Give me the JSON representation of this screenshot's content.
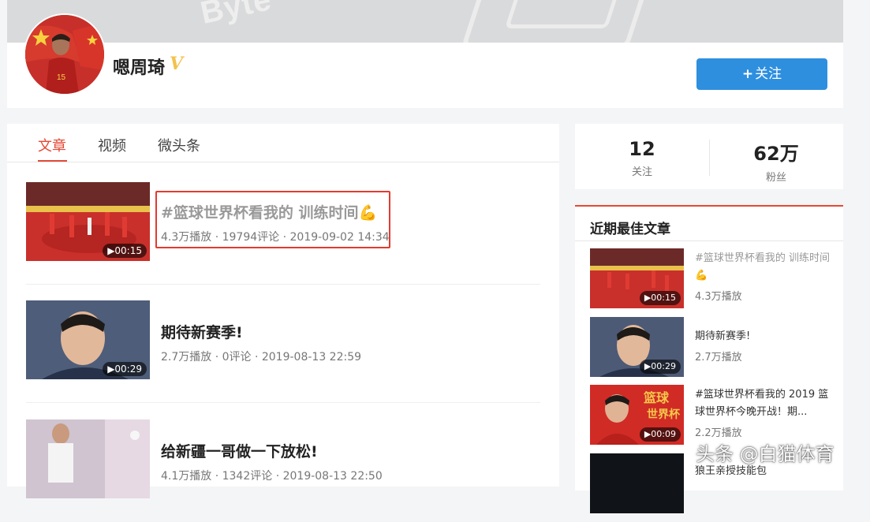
{
  "banner": {
    "logo_text": "Byte"
  },
  "profile": {
    "name": "嗯周琦",
    "verified_badge": "V",
    "follow_label": "关注",
    "follow_plus": "+"
  },
  "tabs": [
    {
      "label": "文章"
    },
    {
      "label": "视频"
    },
    {
      "label": "微头条"
    }
  ],
  "articles": [
    {
      "title": "#篮球世界杯看我的 训练时间💪",
      "meta": "4.3万播放 · 19794评论 · 2019-09-02 14:34",
      "duration": "▶00:15"
    },
    {
      "title": "期待新赛季!",
      "meta": "2.7万播放 · 0评论 · 2019-08-13 22:59",
      "duration": "▶00:29"
    },
    {
      "title": "给新疆一哥做一下放松!",
      "meta": "4.1万播放 · 1342评论 · 2019-08-13 22:50",
      "duration": ""
    }
  ],
  "stats": {
    "following_count": "12",
    "following_label": "关注",
    "fans_count": "62万",
    "fans_label": "粉丝"
  },
  "best": {
    "heading": "近期最佳文章",
    "items": [
      {
        "title": "#篮球世界杯看我的 训练时间💪",
        "meta": "4.3万播放",
        "duration": "▶00:15"
      },
      {
        "title": "期待新赛季!",
        "meta": "2.7万播放",
        "duration": "▶00:29"
      },
      {
        "title": "#篮球世界杯看我的 2019 篮球世界杯今晚开战！期...",
        "meta": "2.2万播放",
        "duration": "▶00:09"
      },
      {
        "title": "狼王亲授技能包",
        "meta": "",
        "duration": ""
      }
    ]
  },
  "watermark": "头条 @白猫体育",
  "colors": {
    "accent": "#e34a35",
    "follow_button": "#2e8fdf",
    "highlight": "#e43a2f",
    "badge": "#f3c24d"
  }
}
